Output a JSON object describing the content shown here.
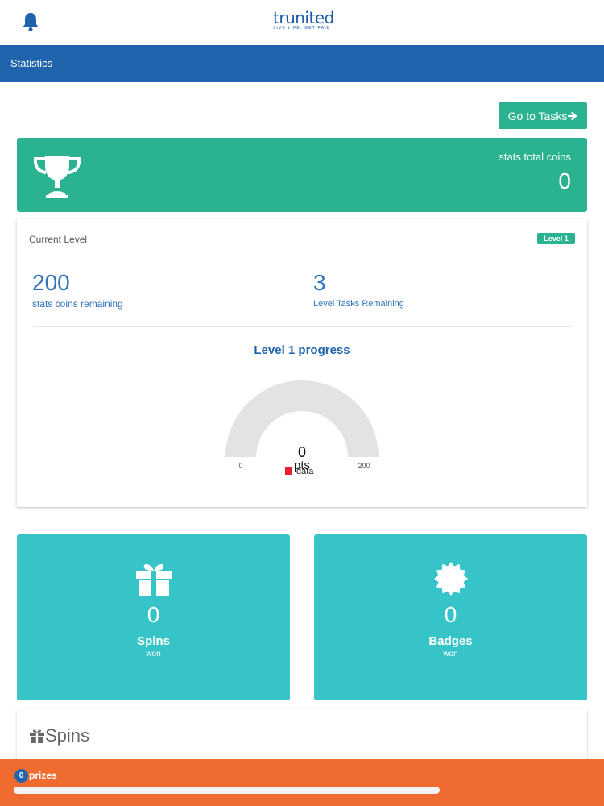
{
  "header": {
    "logo_main": "trunited",
    "logo_tagline": "LIVE LIFE. GET PAID"
  },
  "nav": {
    "title": "Statistics"
  },
  "actions": {
    "go_to_tasks": "Go to Tasks"
  },
  "coins": {
    "label": "stats total coins",
    "value": "0"
  },
  "level": {
    "label": "Current Level",
    "badge": "Level 1",
    "coins_remaining_value": "200",
    "coins_remaining_label": "stats coins remaining",
    "tasks_remaining_value": "3",
    "tasks_remaining_label": "Level Tasks Remaining",
    "progress_title": "Level 1 progress",
    "gauge": {
      "value": "0",
      "unit": "pts",
      "min": "0",
      "max": "200",
      "legend": "data",
      "legend_color": "#e8202a",
      "fraction": 0
    }
  },
  "tiles": {
    "spins": {
      "value": "0",
      "label": "Spins",
      "sub": "won"
    },
    "badges": {
      "value": "0",
      "label": "Badges",
      "sub": "won"
    }
  },
  "spins_section": {
    "title": "Spins"
  },
  "footer": {
    "prize_count": "0",
    "prize_label": "prizes"
  },
  "colors": {
    "brand_blue": "#1f64ad",
    "green": "#2bb391",
    "teal": "#37c4c8",
    "orange": "#ef6b30"
  }
}
